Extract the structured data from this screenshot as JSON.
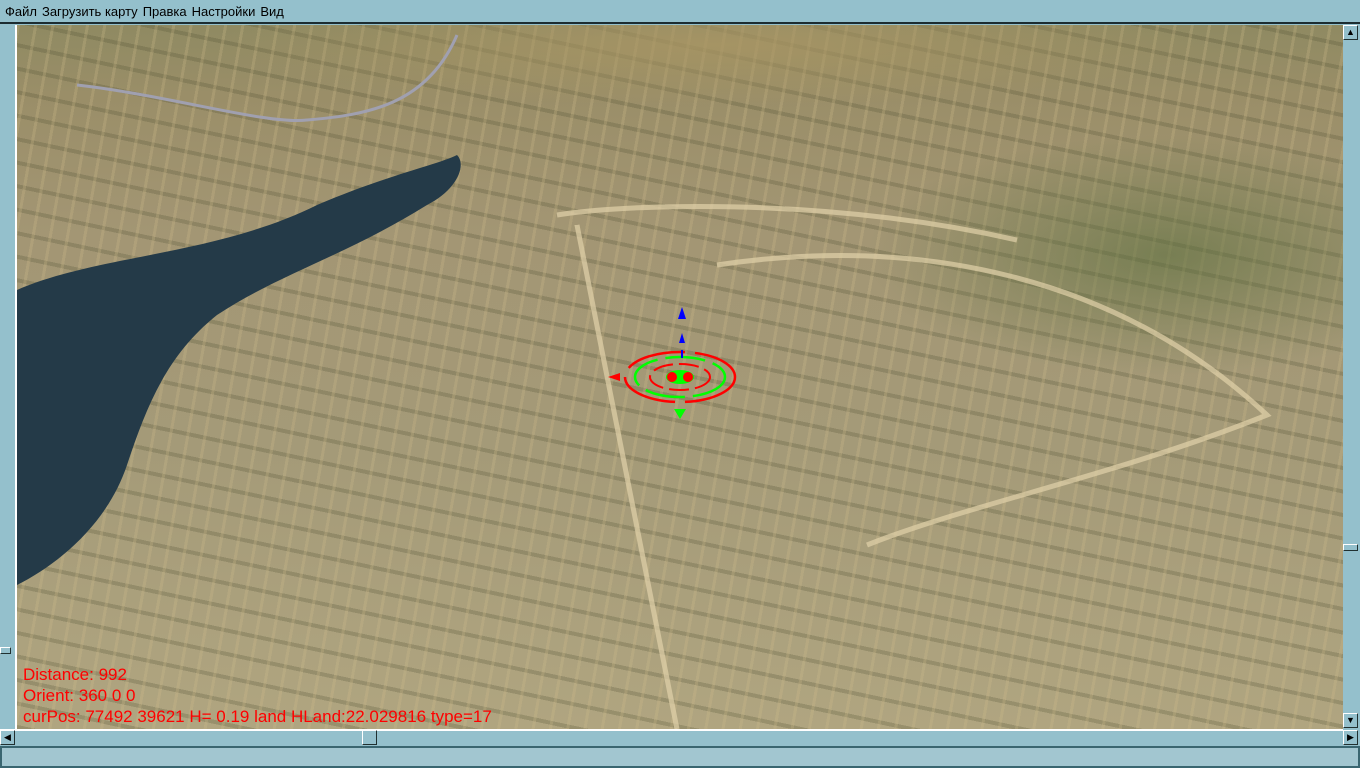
{
  "menu": [
    "Файл",
    "Загрузить карту",
    "Правка",
    "Настройки",
    "Вид"
  ],
  "hud": {
    "distance": "Distance: 992",
    "orient": "Orient: 360 0 0",
    "curpos": "curPos: 77492 39621 H= 0.19 land HLand:22.029816 type=17"
  },
  "colors": {
    "hud_text": "#ff0000",
    "chrome": "#94c0cc",
    "lake": "#243a48"
  },
  "icons": {
    "up": "triangle-up",
    "down": "triangle-down",
    "left": "triangle-left",
    "right": "triangle-right"
  },
  "status": {
    "text": ""
  }
}
